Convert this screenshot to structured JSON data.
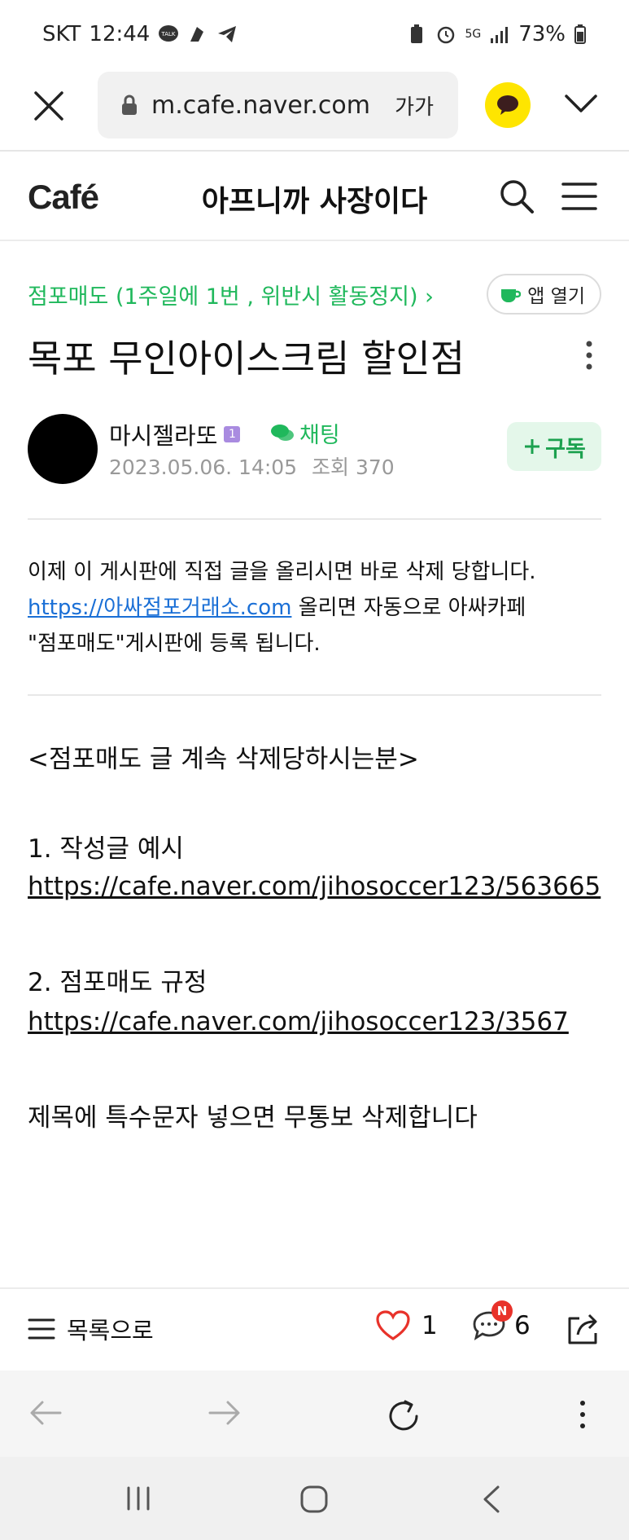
{
  "status_bar": {
    "carrier": "SKT",
    "time": "12:44",
    "battery": "73%",
    "network": "5G"
  },
  "browser": {
    "url": "m.cafe.naver.com",
    "font_size_label": "가가"
  },
  "cafe": {
    "logo": "Café",
    "title": "아프니까 사장이다"
  },
  "post": {
    "board": "점포매도 (1주일에 1번 , 위반시 활동정지) ›",
    "app_open_label": "앱 열기",
    "title": "목포 무인아이스크림 할인점",
    "author": "마시젤라또",
    "level": "1",
    "chat_label": "채팅",
    "date": "2023.05.06. 14:05",
    "views_label": "조회 370",
    "subscribe_label": "구독",
    "notice_line1": "이제 이 게시판에 직접 글을 올리시면 바로 삭제 당합니다.",
    "notice_link": "https://아싸점포거래소.com",
    "notice_line2_rest": " 올리면 자동으로 아싸카페",
    "notice_line3": "\"점포매도\"게시판에 등록 됩니다.",
    "body_heading": "<점포매도 글 계속 삭제당하시는분>",
    "item1_label": "1. 작성글 예시",
    "item1_link": "https://cafe.naver.com/jihosoccer123/563665",
    "item2_label": "2. 점포매도 규정",
    "item2_link": "https://cafe.naver.com/jihosoccer123/3567",
    "footer_text": "제목에 특수문자 넣으면 무통보 삭제합니다"
  },
  "actions": {
    "list_label": "목록으로",
    "likes": "1",
    "comments": "6",
    "new_badge": "N"
  },
  "colors": {
    "naver_green": "#20b85c",
    "link_blue": "#1a6fd6",
    "kakao_yellow": "#fee500",
    "heart_red": "#e8322a"
  },
  "icons": [
    "close-icon",
    "lock-icon",
    "kakao-icon",
    "chevron-down-icon",
    "search-icon",
    "menu-icon",
    "more-icon",
    "chat-icon",
    "heart-icon",
    "comment-icon",
    "share-icon",
    "back-icon",
    "forward-icon",
    "reload-icon"
  ]
}
